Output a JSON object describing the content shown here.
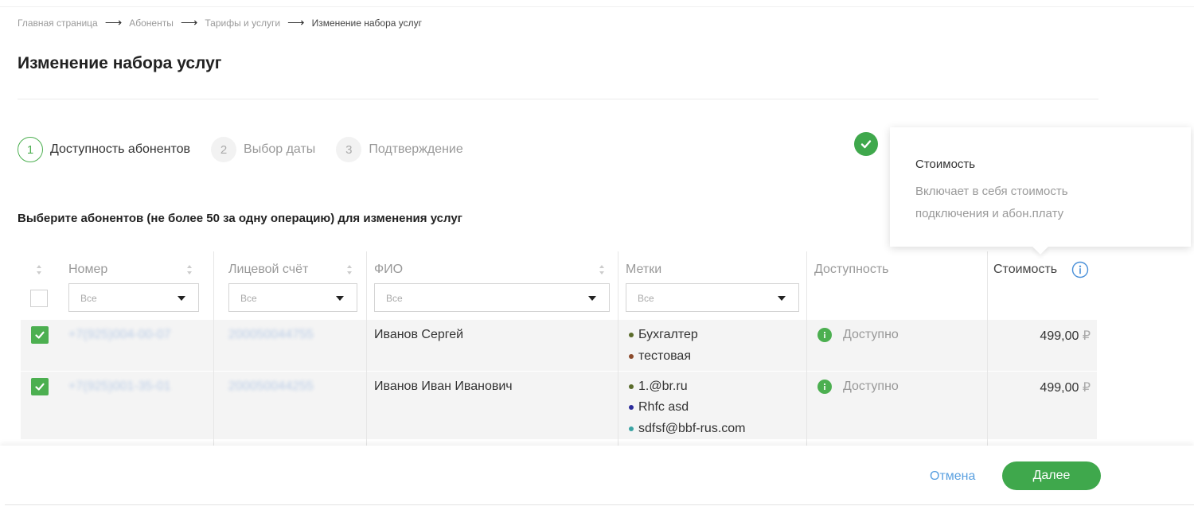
{
  "breadcrumb": [
    {
      "label": "Главная страница"
    },
    {
      "label": "Абоненты"
    },
    {
      "label": "Тарифы и услуги"
    },
    {
      "label": "Изменение набора услуг"
    }
  ],
  "page": {
    "title": "Изменение набора услуг",
    "subtitle": "Выберите абонентов (не более 50 за одну операцию) для изменения услуг"
  },
  "steps": [
    {
      "num": "1",
      "label": "Доступность абонентов",
      "state": "active"
    },
    {
      "num": "2",
      "label": "Выбор даты",
      "state": "inactive"
    },
    {
      "num": "3",
      "label": "Подтверждение",
      "state": "inactive"
    }
  ],
  "tooltip": {
    "title": "Стоимость",
    "text": "Включает в себя стоимость подключения и абон.плату"
  },
  "table": {
    "columns": {
      "number": "Номер",
      "account": "Лицевой счёт",
      "fio": "ФИО",
      "tags": "Метки",
      "availability": "Доступность",
      "cost": "Стоимость"
    },
    "filters": {
      "number": "Все",
      "account": "Все",
      "fio": "Все",
      "tags": "Все"
    },
    "rows": [
      {
        "checked": true,
        "number": "+7(925)004-00-07",
        "account": "200050044755",
        "fio": "Иванов Сергей",
        "tags": [
          {
            "label": "Бухгалтер",
            "color": "#5a6b2a"
          },
          {
            "label": "тестовая",
            "color": "#8b4a2b"
          }
        ],
        "availability": "Доступно",
        "cost": "499,00",
        "currency": "₽"
      },
      {
        "checked": true,
        "number": "+7(925)001-35-01",
        "account": "200050044255",
        "fio": "Иванов Иван Иванович",
        "tags": [
          {
            "label": "1.@br.ru",
            "color": "#5a6b2a"
          },
          {
            "label": "Rhfc asd",
            "color": "#2b2b9b"
          },
          {
            "label": "sdfsf@bbf-rus.com",
            "color": "#3aa3a3"
          }
        ],
        "availability": "Доступно",
        "cost": "499,00",
        "currency": "₽"
      }
    ]
  },
  "footer": {
    "cancel": "Отмена",
    "next": "Далее"
  },
  "colors": {
    "accent_green": "#3fa84c",
    "link_blue": "#5aa0e0",
    "row_bg": "#f4f4f4"
  }
}
